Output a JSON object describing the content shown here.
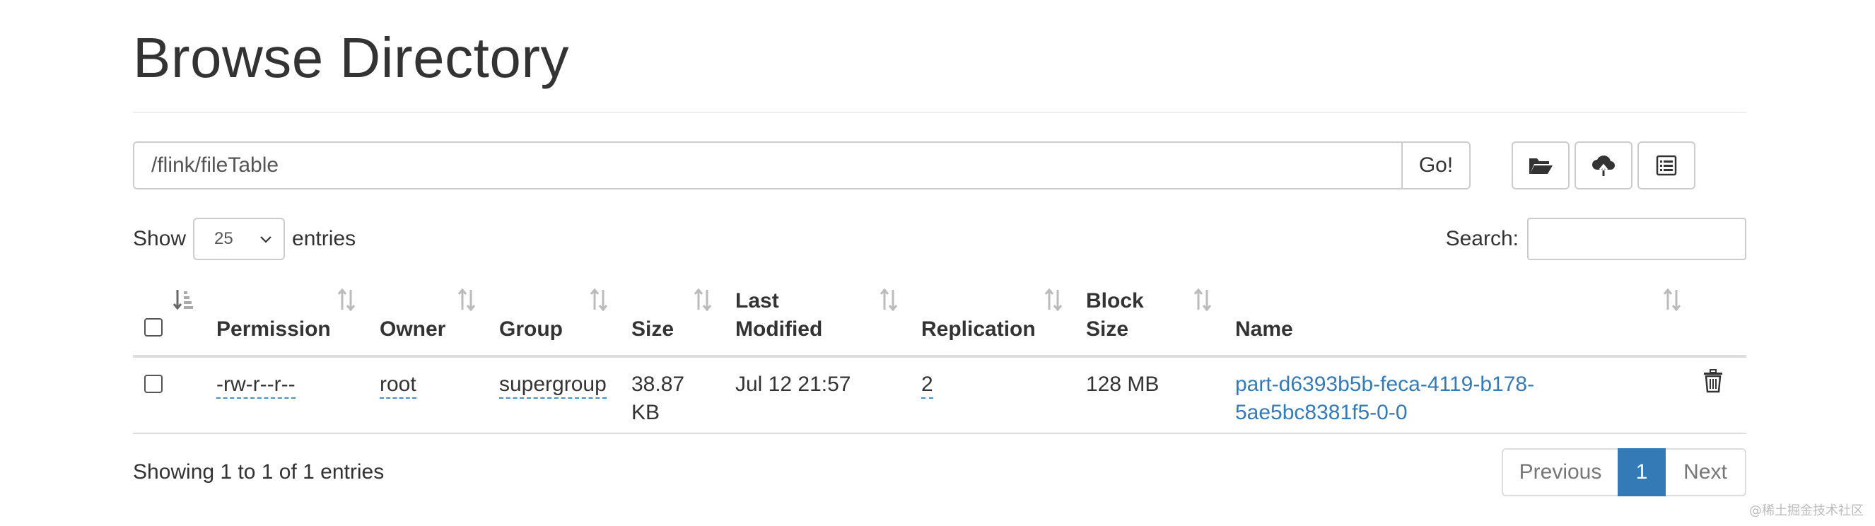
{
  "page": {
    "title": "Browse Directory"
  },
  "pathbar": {
    "path": "/flink/fileTable",
    "go_label": "Go!"
  },
  "toolbar": {
    "buttons": [
      {
        "icon": "folder-open-icon"
      },
      {
        "icon": "cloud-upload-icon"
      },
      {
        "icon": "list-alt-icon"
      }
    ]
  },
  "length": {
    "show_label": "Show",
    "value": "25",
    "entries_label": "entries"
  },
  "search": {
    "label": "Search:",
    "value": ""
  },
  "table": {
    "columns": [
      {
        "label": ""
      },
      {
        "label": "Permission"
      },
      {
        "label": "Owner"
      },
      {
        "label": "Group"
      },
      {
        "label": "Size"
      },
      {
        "label_line1": "Last",
        "label_line2": "Modified"
      },
      {
        "label": "Replication"
      },
      {
        "label_line1": "Block",
        "label_line2": "Size"
      },
      {
        "label": "Name"
      }
    ],
    "rows": [
      {
        "permission": "-rw-r--r--",
        "owner": "root",
        "group": "supergroup",
        "size_line1": "38.87",
        "size_line2": "KB",
        "last_modified": "Jul 12 21:57",
        "replication": "2",
        "block_size": "128 MB",
        "name_line1": "part-d6393b5b-feca-4119-b178-",
        "name_line2": "5ae5bc8381f5-0-0"
      }
    ]
  },
  "info": "Showing 1 to 1 of 1 entries",
  "pagination": {
    "previous": "Previous",
    "current": "1",
    "next": "Next"
  },
  "watermark": "@稀土掘金技术社区",
  "colors": {
    "link": "#337ab7",
    "active_page": "#337ab7",
    "border": "#cccccc"
  }
}
